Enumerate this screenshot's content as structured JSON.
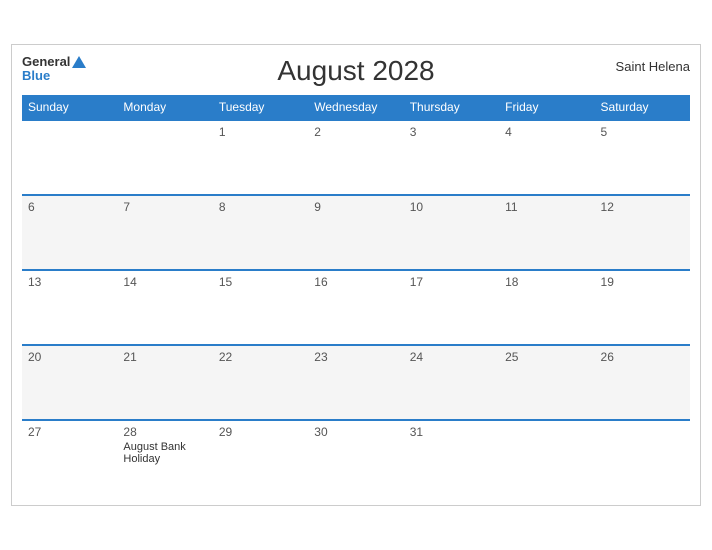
{
  "header": {
    "title": "August 2028",
    "location": "Saint Helena",
    "logo_general": "General",
    "logo_blue": "Blue"
  },
  "weekdays": [
    "Sunday",
    "Monday",
    "Tuesday",
    "Wednesday",
    "Thursday",
    "Friday",
    "Saturday"
  ],
  "weeks": [
    [
      {
        "date": "",
        "event": ""
      },
      {
        "date": "",
        "event": ""
      },
      {
        "date": "1",
        "event": ""
      },
      {
        "date": "2",
        "event": ""
      },
      {
        "date": "3",
        "event": ""
      },
      {
        "date": "4",
        "event": ""
      },
      {
        "date": "5",
        "event": ""
      }
    ],
    [
      {
        "date": "6",
        "event": ""
      },
      {
        "date": "7",
        "event": ""
      },
      {
        "date": "8",
        "event": ""
      },
      {
        "date": "9",
        "event": ""
      },
      {
        "date": "10",
        "event": ""
      },
      {
        "date": "11",
        "event": ""
      },
      {
        "date": "12",
        "event": ""
      }
    ],
    [
      {
        "date": "13",
        "event": ""
      },
      {
        "date": "14",
        "event": ""
      },
      {
        "date": "15",
        "event": ""
      },
      {
        "date": "16",
        "event": ""
      },
      {
        "date": "17",
        "event": ""
      },
      {
        "date": "18",
        "event": ""
      },
      {
        "date": "19",
        "event": ""
      }
    ],
    [
      {
        "date": "20",
        "event": ""
      },
      {
        "date": "21",
        "event": ""
      },
      {
        "date": "22",
        "event": ""
      },
      {
        "date": "23",
        "event": ""
      },
      {
        "date": "24",
        "event": ""
      },
      {
        "date": "25",
        "event": ""
      },
      {
        "date": "26",
        "event": ""
      }
    ],
    [
      {
        "date": "27",
        "event": ""
      },
      {
        "date": "28",
        "event": "August Bank Holiday"
      },
      {
        "date": "29",
        "event": ""
      },
      {
        "date": "30",
        "event": ""
      },
      {
        "date": "31",
        "event": ""
      },
      {
        "date": "",
        "event": ""
      },
      {
        "date": "",
        "event": ""
      }
    ]
  ]
}
